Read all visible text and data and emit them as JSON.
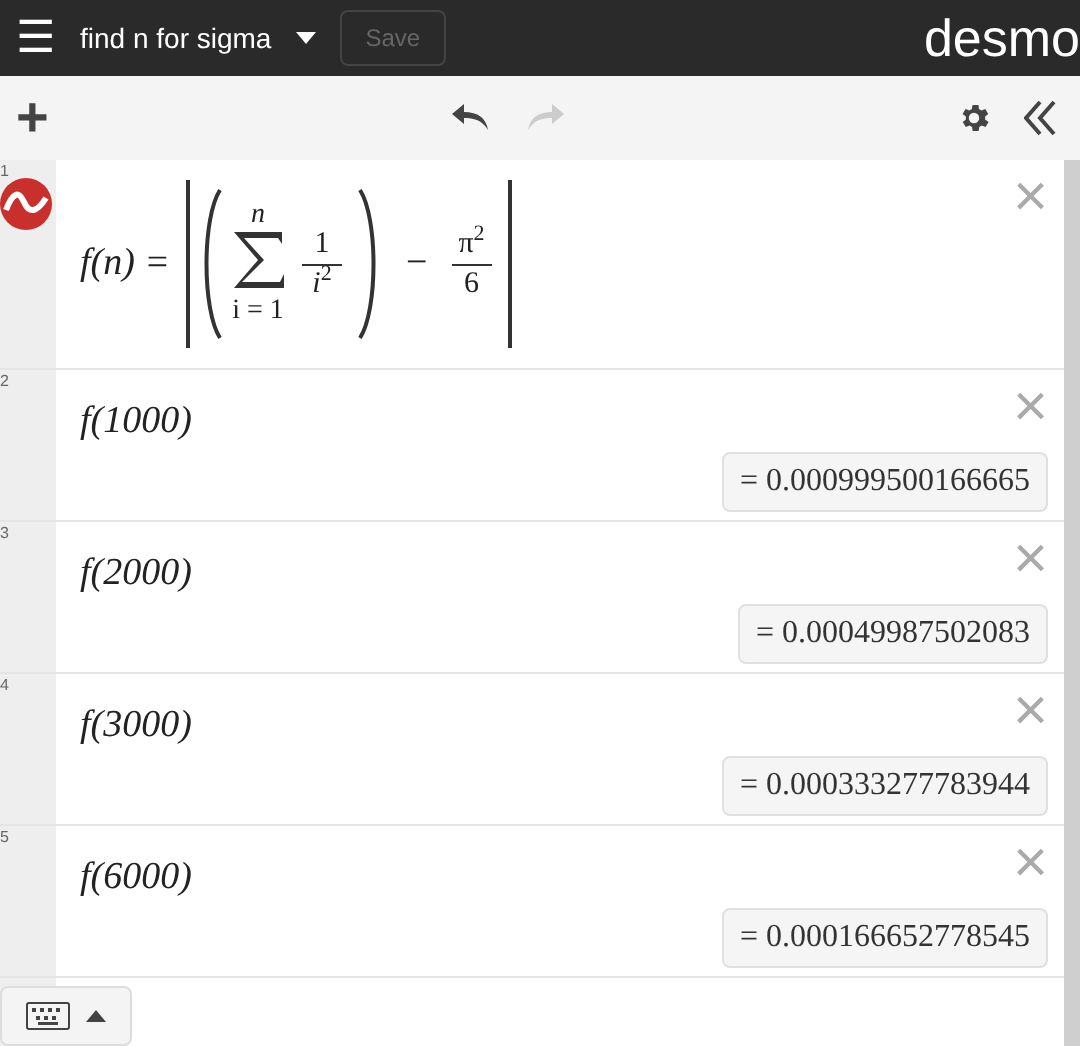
{
  "header": {
    "menu": "☰",
    "title": "find n for sigma",
    "save": "Save",
    "save_disabled": true,
    "brand": "desmo"
  },
  "toolbar": {
    "add": "+"
  },
  "definition": {
    "number": "1",
    "lhs": "f(n) =",
    "sum_upper": "n",
    "sum_lower": "i = 1",
    "term_num": "1",
    "term_den": "i",
    "term_den_exp": "2",
    "operator": "−",
    "const_num": "π",
    "const_num_exp": "2",
    "const_den": "6",
    "delete": "×"
  },
  "expressions": [
    {
      "number": "2",
      "input": "f(1000)",
      "result": "= 0.000999500166665",
      "delete": "×"
    },
    {
      "number": "3",
      "input": "f(2000)",
      "result": "= 0.00049987502083",
      "delete": "×"
    },
    {
      "number": "4",
      "input": "f(3000)",
      "result": "= 0.000333277783944",
      "delete": "×"
    },
    {
      "number": "5",
      "input": "f(6000)",
      "result": "= 0.000166652778545",
      "delete": "×"
    }
  ]
}
